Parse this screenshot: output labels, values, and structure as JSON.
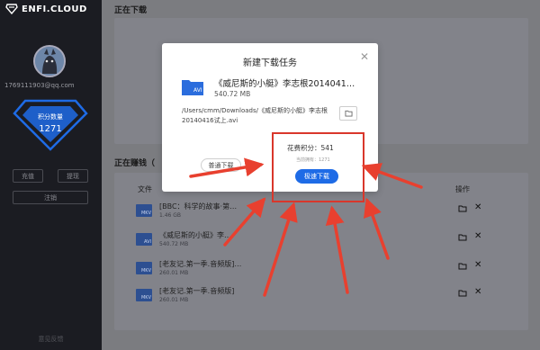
{
  "sidebar": {
    "logo_text": "ENFI.CLOUD",
    "email": "1769111903@qq.com",
    "points_label": "积分数量",
    "points_value": "1271",
    "buttons": [
      "充值",
      "提现",
      "注销"
    ],
    "feedback": "意见反馈"
  },
  "main": {
    "downloading_title": "正在下载",
    "earning_title": "正在赚钱（",
    "col_file": "文件",
    "col_ops": "操作",
    "rows": [
      {
        "name": "[BBC：科学的故事·第…",
        "size": "1.46 GB",
        "ext": "MKV"
      },
      {
        "name": "《威尼斯的小艇》李…",
        "size": "540.72 MB",
        "ext": "AVI"
      },
      {
        "name": "[老友记.第一季.音频版]…",
        "size": "260.01 MB",
        "ext": "MKV"
      },
      {
        "name": "[老友记.第一季.音频版]",
        "size": "260.01 MB",
        "ext": "MKV"
      }
    ]
  },
  "modal": {
    "title": "新建下载任务",
    "file_name": "《威尼斯的小艇》李志根2014041…",
    "file_ext": "AVI",
    "file_size": "540.72 MB",
    "path": "/Users/cmm/Downloads/《威尼斯的小艇》李志根20140416试上.avi",
    "normal_btn": "普通下载",
    "cost_label": "花费积分：541",
    "have_label": "当前拥有：1271",
    "fast_btn": "极速下载"
  },
  "colors": {
    "accent": "#1e6be6",
    "annotation": "#d9372b",
    "sidebar_bg": "#1b1c22"
  }
}
